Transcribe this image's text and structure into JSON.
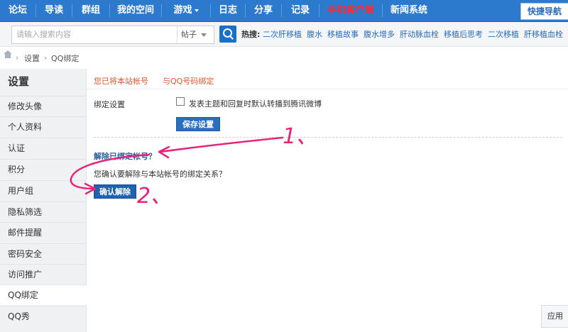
{
  "topnav": {
    "items": [
      "论坛",
      "导读",
      "群组",
      "我的空间",
      "游戏",
      "日志",
      "分享",
      "记录",
      "手机客户端",
      "新闻系统"
    ],
    "quick_nav": "快捷导航"
  },
  "search": {
    "placeholder": "请输入搜索内容",
    "type": "帖子",
    "hot_label": "热搜:",
    "hot_links": [
      "二次肝移植",
      "腹水",
      "移植故事",
      "腹水增多",
      "肝动脉血栓",
      "移植后思考",
      "二次移植",
      "肝移植血栓"
    ]
  },
  "breadcrumb": {
    "items": [
      "设置",
      "QQ绑定"
    ]
  },
  "sidebar": {
    "title": "设置",
    "items": [
      "修改头像",
      "个人资料",
      "认证",
      "积分",
      "用户组",
      "隐私筛选",
      "邮件提醒",
      "密码安全",
      "访问推广",
      "QQ绑定",
      "QQ秀"
    ],
    "active": "QQ绑定"
  },
  "main": {
    "tabs": [
      "您已将本站帐号",
      "与QQ号码绑定"
    ],
    "bind_label": "绑定设置",
    "checkbox_label": "发表主题和回复时默认转播到腾讯微博",
    "save_button": "保存设置",
    "unbind_title": "解除已绑定帐号？",
    "confirm_text": "您确认要解除与本站帐号的绑定关系？",
    "confirm_button": "确认解除"
  },
  "right_tab": "应用",
  "annotations": {
    "color": "#e8247a",
    "label1": "1、",
    "label2": "2、"
  }
}
